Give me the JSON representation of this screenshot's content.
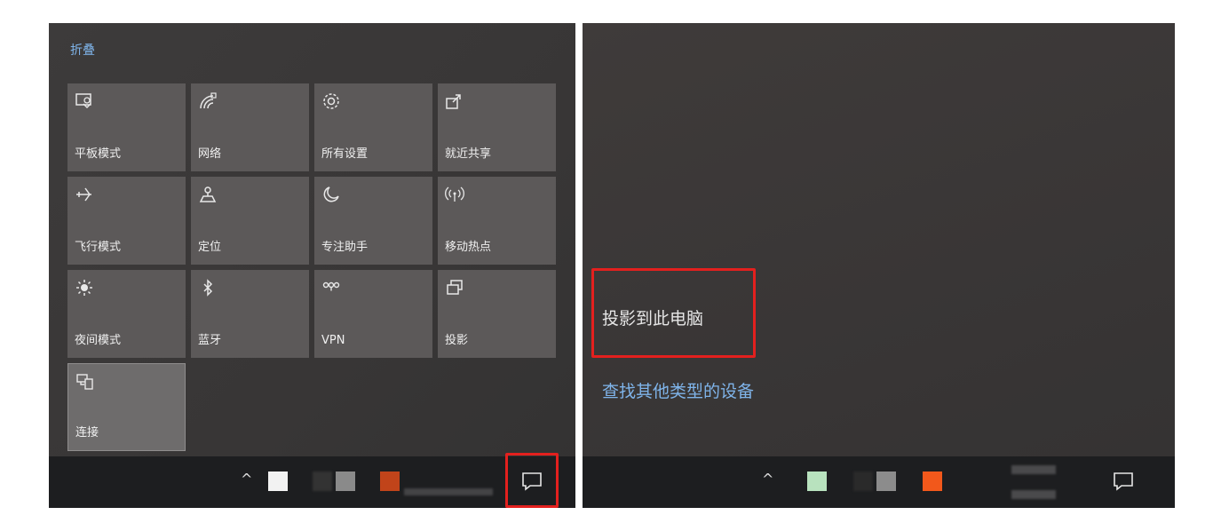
{
  "left": {
    "collapse_label": "折叠",
    "tiles": [
      {
        "label": "平板模式",
        "icon": "tablet-mode-icon",
        "active": false
      },
      {
        "label": "网络",
        "icon": "network-icon",
        "active": false
      },
      {
        "label": "所有设置",
        "icon": "gear-icon",
        "active": false
      },
      {
        "label": "就近共享",
        "icon": "nearby-share-icon",
        "active": false
      },
      {
        "label": "飞行模式",
        "icon": "airplane-icon",
        "active": false
      },
      {
        "label": "定位",
        "icon": "location-icon",
        "active": false
      },
      {
        "label": "专注助手",
        "icon": "moon-icon",
        "active": false
      },
      {
        "label": "移动热点",
        "icon": "hotspot-icon",
        "active": false
      },
      {
        "label": "夜间模式",
        "icon": "night-light-icon",
        "active": false
      },
      {
        "label": "蓝牙",
        "icon": "bluetooth-icon",
        "active": false
      },
      {
        "label": "VPN",
        "icon": "vpn-icon",
        "active": false
      },
      {
        "label": "投影",
        "icon": "project-icon",
        "active": false
      },
      {
        "label": "连接",
        "icon": "connect-icon",
        "active": true
      }
    ],
    "taskbar": {
      "chevron": "^",
      "tray_colors": [
        "#f2f2f2",
        "#333333",
        "#8a8a8a",
        "#c1441a"
      ]
    }
  },
  "right": {
    "project_to_pc": "投影到此电脑",
    "find_other_devices": "查找其他类型的设备",
    "taskbar": {
      "chevron": "^",
      "tray_colors": [
        "#b8e2be",
        "#2a2a2a",
        "#8c8c8c",
        "#f2581b"
      ]
    }
  },
  "colors": {
    "accent_link": "#7fb4ea",
    "highlight_red": "#e3201e",
    "tile": "#5c5959",
    "taskbar": "#1d1e20"
  }
}
